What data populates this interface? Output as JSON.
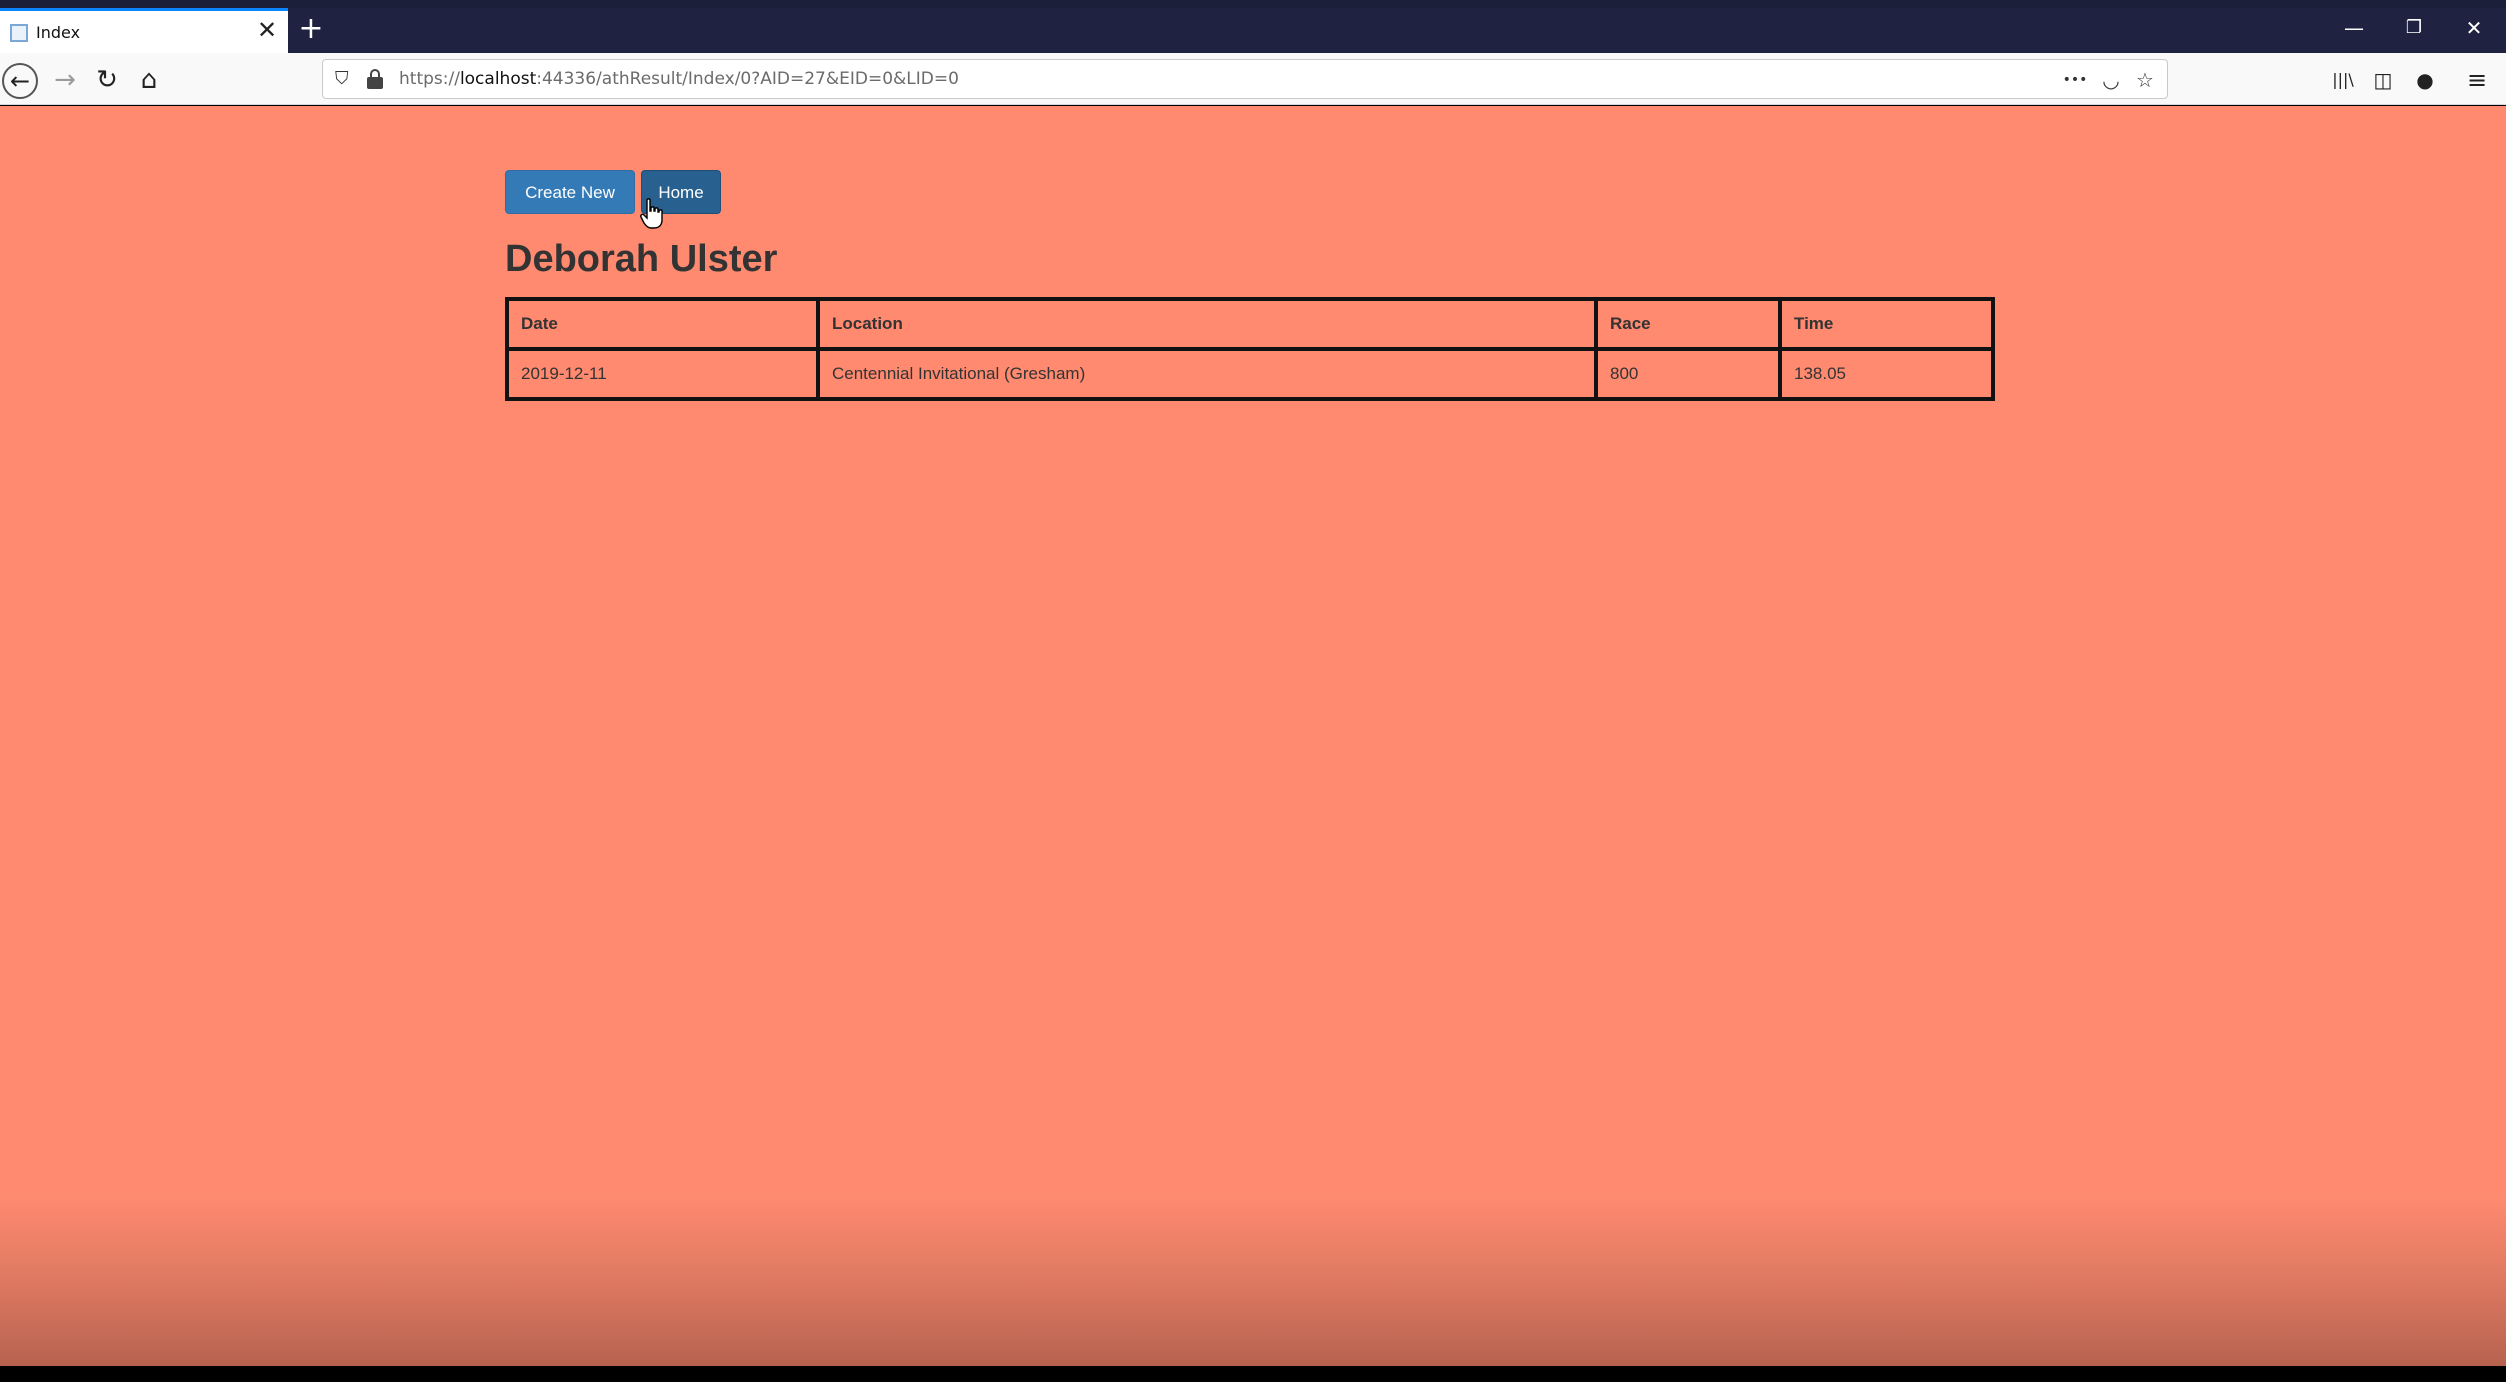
{
  "browser": {
    "tab": {
      "title": "Index",
      "close_glyph": "✕",
      "icon": "page-icon"
    },
    "new_tab_glyph": "+",
    "window_controls": {
      "minimize": "—",
      "restore": "❐",
      "close": "✕"
    },
    "nav": {
      "back_glyph": "←",
      "forward_glyph": "→",
      "reload_glyph": "↻",
      "home_glyph": "⌂"
    },
    "urlbar": {
      "scheme": "https://",
      "host": "localhost",
      "rest": ":44336/athResult/Index/0?AID=27&EID=0&LID=0",
      "more_glyph": "•••",
      "pocket_glyph": "◡",
      "bookmark_glyph": "☆"
    },
    "toolbar": {
      "library_glyph": "|||\\",
      "sidebar_glyph": "◫",
      "account_glyph": "●",
      "menu_glyph": "≡"
    }
  },
  "page": {
    "buttons": {
      "create_new": "Create New",
      "home": "Home"
    },
    "athlete_name": "Deborah Ulster",
    "table": {
      "headers": [
        "Date",
        "Location",
        "Race",
        "Time"
      ],
      "rows": [
        [
          "2019-12-11",
          "Centennial Invitational (Gresham)",
          "800",
          "138.05"
        ]
      ]
    }
  },
  "colors": {
    "page_background": "#ff8a70",
    "button_primary": "#337ab7",
    "button_active": "#286090",
    "tab_strip": "#1f2240"
  }
}
